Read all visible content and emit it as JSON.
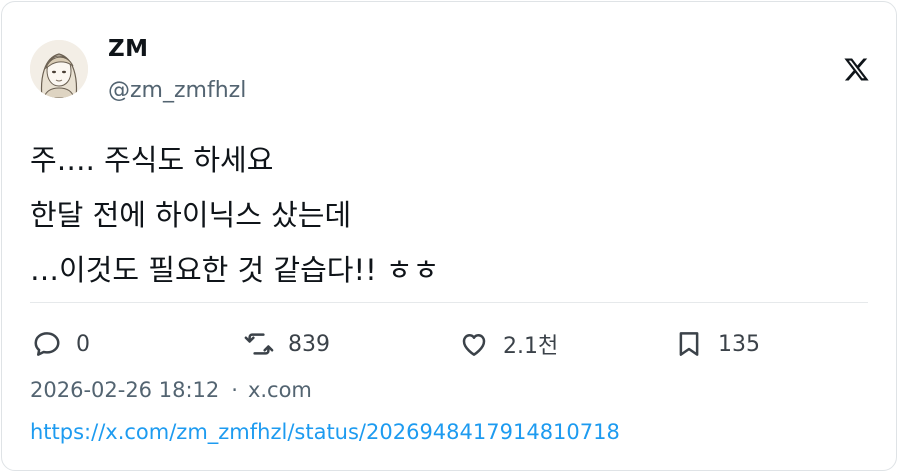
{
  "author": {
    "display_name": "ZM",
    "handle": "@zm_zmfhzl"
  },
  "post": {
    "lines": [
      "주…. 주식도 하세요",
      "한달 전에 하이닉스 샀는데",
      "…이것도 필요한 것 같습다!! ㅎㅎ"
    ]
  },
  "actions": {
    "reply_count": "0",
    "repost_count": "839",
    "like_count": "2.1천",
    "bookmark_count": "135"
  },
  "meta": {
    "timestamp": "2026-02-26 18:12",
    "separator": "·",
    "source": "x.com"
  },
  "link": {
    "url": "https://x.com/zm_zmfhzl/status/2026948417914810718"
  },
  "icons": {
    "brand": "x-logo-icon",
    "reply": "speech-bubble-icon",
    "repost": "repost-arrows-icon",
    "like": "heart-icon",
    "bookmark": "bookmark-icon"
  },
  "colors": {
    "text": "#0f1419",
    "secondary": "#536471",
    "link": "#1d9bf0",
    "border": "#dfe3e6"
  }
}
